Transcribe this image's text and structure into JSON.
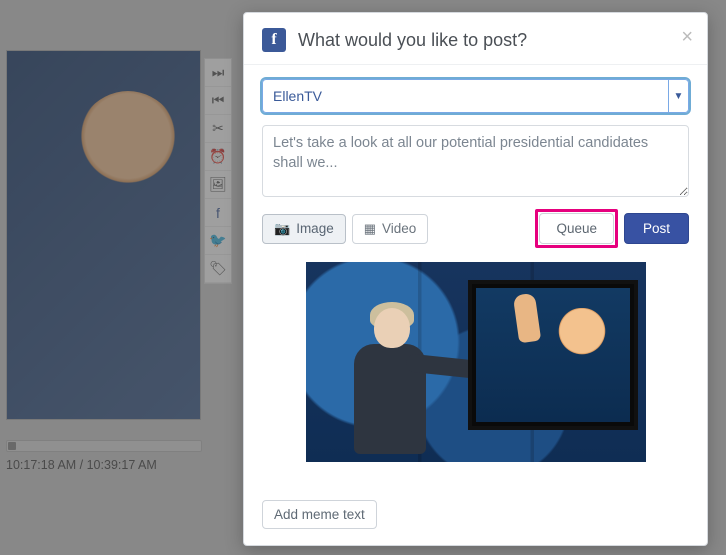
{
  "modal": {
    "title": "What would you like to post?",
    "account_selected": "EllenTV",
    "post_text": "Let's take a look at all our potential presidential candidates shall we...",
    "image_btn_label": "Image",
    "video_btn_label": "Video",
    "queue_btn_label": "Queue",
    "post_btn_label": "Post",
    "addmeme_label": "Add meme text"
  },
  "bg": {
    "timestamps": "10:17:18 AM / 10:39:17 AM"
  },
  "icons": {
    "camera": "📷",
    "film": "▦",
    "skip_forward": "⏭",
    "skip_back": "⏮",
    "scissors": "✂",
    "clock": "⏰",
    "picture": "🖼",
    "facebook": "f",
    "twitter": "🐦",
    "tag": "🏷"
  }
}
